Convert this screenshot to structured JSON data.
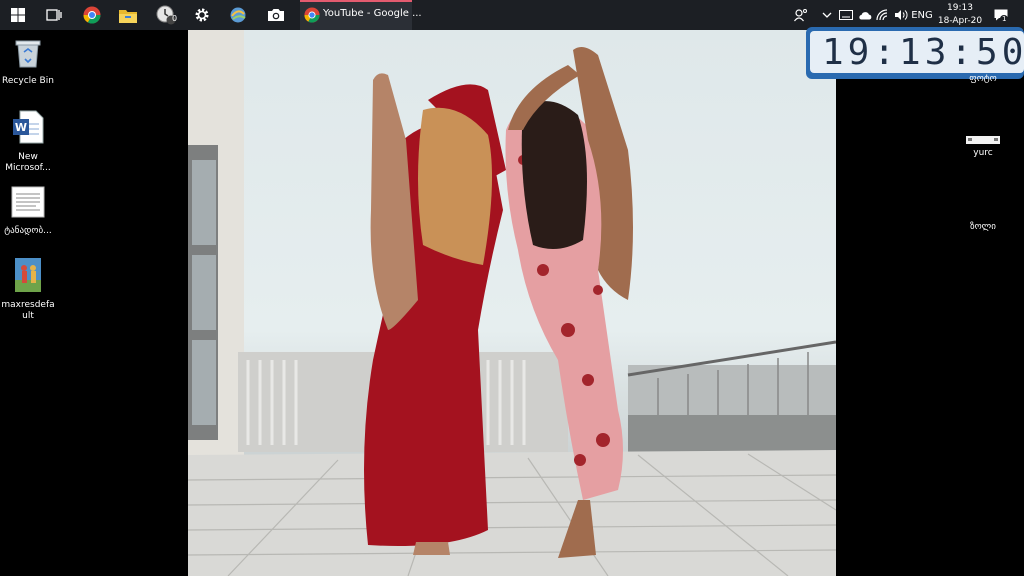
{
  "taskbar": {
    "active_window_title": "YouTube - Google ...",
    "badges": {
      "clock_app": "0"
    },
    "tray": {
      "language": "ENG",
      "time": "19:13",
      "date": "18-Apr-20",
      "notification_count": "1"
    }
  },
  "desktop_left": [
    {
      "label": "Recycle Bin",
      "icon": "recycle-bin-icon"
    },
    {
      "label": "New Microsof...",
      "icon": "word-document-icon"
    },
    {
      "label": "ტანადობ...",
      "icon": "text-document-icon"
    },
    {
      "label": "maxresdefault",
      "icon": "image-file-icon"
    }
  ],
  "desktop_right": [
    {
      "label": "ფოტო",
      "icon": "folder-icon"
    },
    {
      "label": "yurc",
      "icon": "file-icon"
    },
    {
      "label": "ზოლი",
      "icon": "file-icon"
    }
  ],
  "widget": {
    "time": "19:13:50"
  },
  "colors": {
    "taskbar": "#1c1f24",
    "active_accent": "#e35b6f",
    "widget_frame": "#2a6ab0"
  }
}
